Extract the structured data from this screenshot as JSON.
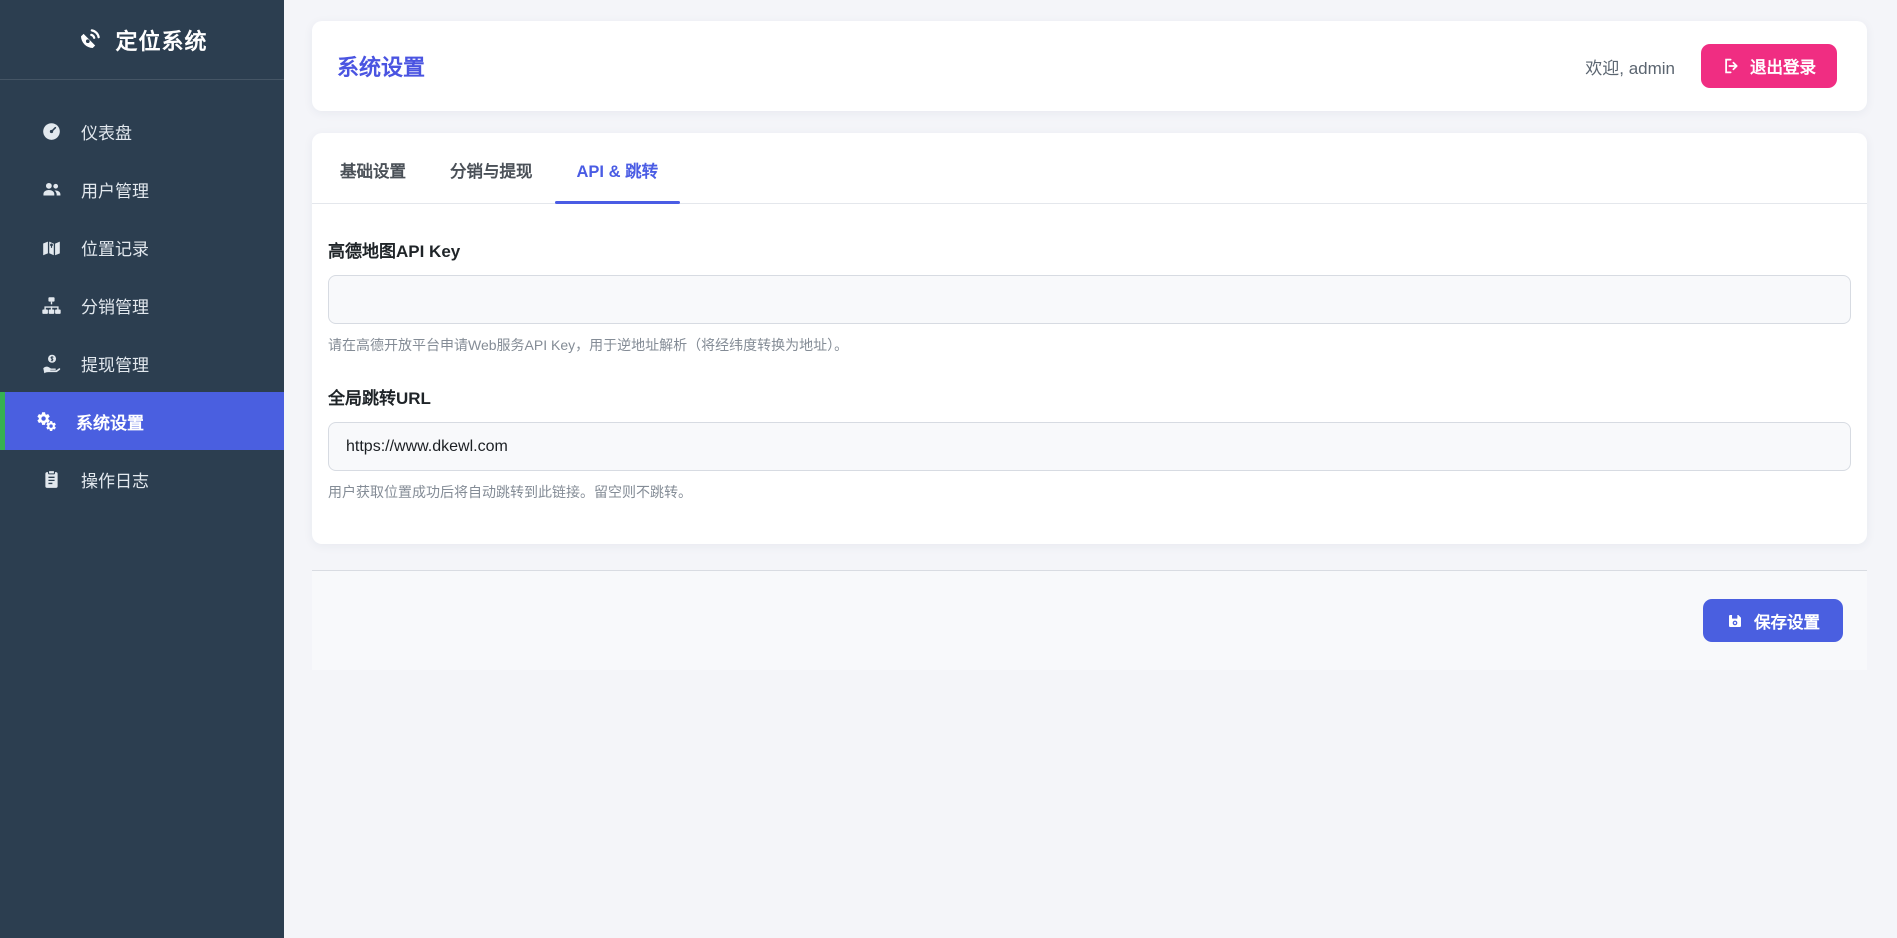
{
  "app": {
    "title": "定位系统"
  },
  "sidebar": {
    "items": [
      {
        "label": "仪表盘",
        "icon": "gauge-icon"
      },
      {
        "label": "用户管理",
        "icon": "users-icon"
      },
      {
        "label": "位置记录",
        "icon": "map-icon"
      },
      {
        "label": "分销管理",
        "icon": "sitemap-icon"
      },
      {
        "label": "提现管理",
        "icon": "hand-dollar-icon"
      },
      {
        "label": "系统设置",
        "icon": "gears-icon",
        "active": true
      },
      {
        "label": "操作日志",
        "icon": "clipboard-icon"
      }
    ]
  },
  "topbar": {
    "title": "系统设置",
    "welcome": "欢迎, admin",
    "logout_label": "退出登录"
  },
  "tabs": [
    {
      "label": "基础设置",
      "active": false
    },
    {
      "label": "分销与提现",
      "active": false
    },
    {
      "label": "API & 跳转",
      "active": true
    }
  ],
  "form": {
    "fields": [
      {
        "label": "高德地图API Key",
        "value": "",
        "help": "请在高德开放平台申请Web服务API Key，用于逆地址解析（将经纬度转换为地址）。"
      },
      {
        "label": "全局跳转URL",
        "value": "https://www.dkewl.com",
        "help": "用户获取位置成功后将自动跳转到此链接。留空则不跳转。"
      }
    ],
    "save_label": "保存设置"
  },
  "colors": {
    "sidebar_bg": "#2c3e50",
    "primary_blue": "#4a5fe0",
    "accent_pink": "#f02d82",
    "active_green": "#36b052",
    "page_bg": "#f4f5f9"
  }
}
